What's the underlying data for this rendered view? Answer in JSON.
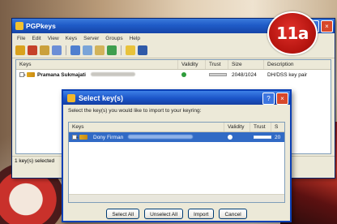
{
  "main_window": {
    "title": "PGPkeys",
    "menu": [
      "File",
      "Edit",
      "View",
      "Keys",
      "Server",
      "Groups",
      "Help"
    ],
    "columns": [
      "Keys",
      "Validity",
      "Trust",
      "Size",
      "Description"
    ],
    "rows": [
      {
        "name": "Pramana Sukmajati",
        "size": "2048/1024",
        "description": "DH/DSS key pair"
      }
    ],
    "status": "1 key(s) selected"
  },
  "badge": {
    "text": "11a"
  },
  "dialog": {
    "title": "Select key(s)",
    "instruction": "Select the key(s) you would like to import to your keyring:",
    "columns": [
      "Keys",
      "Validity",
      "Trust",
      "S"
    ],
    "rows": [
      {
        "name": "Dony Firman",
        "size_partial": "20"
      }
    ],
    "buttons": {
      "select_all": "Select All",
      "unselect_all": "Unselect All",
      "import": "Import",
      "cancel": "Cancel"
    }
  },
  "colors": {
    "titlebar": "#1f5bc7",
    "selection": "#316ac5",
    "badge": "#c8171a",
    "close_button": "#d7482b"
  }
}
